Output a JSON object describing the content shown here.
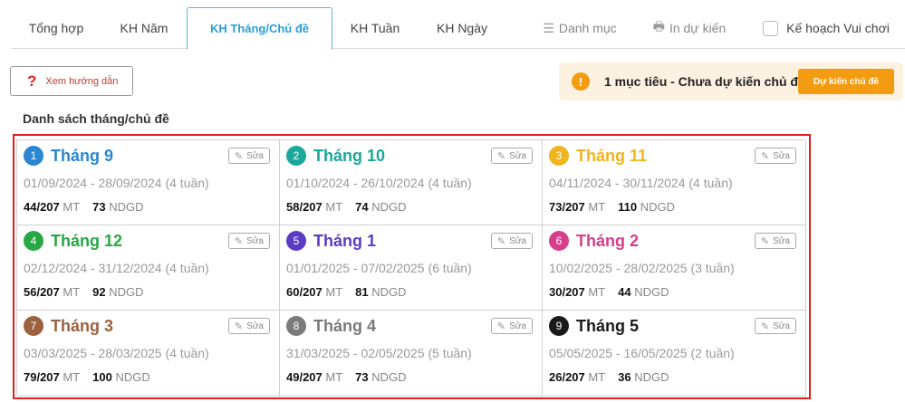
{
  "tabs": [
    {
      "label": "Tổng hợp"
    },
    {
      "label": "KH Năm"
    },
    {
      "label": "KH Tháng/Chủ đề"
    },
    {
      "label": "KH Tuần"
    },
    {
      "label": "KH Ngày"
    },
    {
      "label": "Danh mục",
      "icon": "list-icon"
    },
    {
      "label": "In dự kiến",
      "icon": "print-icon"
    },
    {
      "label": "Kế hoạch Vui chơi"
    }
  ],
  "help_button": {
    "label": "Xem hướng dẫn",
    "icon": "?"
  },
  "alert": {
    "icon": "!",
    "message": "1 mục tiêu - Chưa dự kiến chủ đề",
    "button": "Dự kiến chủ đề",
    "color": "#f39c12"
  },
  "section_title": "Danh sách tháng/chủ đề",
  "edit_label": "Sửa",
  "months": [
    {
      "num": "1",
      "name": "Tháng 9",
      "color": "#2a86d1",
      "dates": "01/09/2024 - 28/09/2024 (4 tuần)",
      "mt": "44/207",
      "mt_label": "MT",
      "ndgd": "73",
      "ndgd_label": "NDGD"
    },
    {
      "num": "2",
      "name": "Tháng 10",
      "color": "#1aa89a",
      "dates": "01/10/2024 - 26/10/2024 (4 tuần)",
      "mt": "58/207",
      "mt_label": "MT",
      "ndgd": "74",
      "ndgd_label": "NDGD"
    },
    {
      "num": "3",
      "name": "Tháng 11",
      "color": "#f0b41c",
      "dates": "04/11/2024 - 30/11/2024 (4 tuần)",
      "mt": "73/207",
      "mt_label": "MT",
      "ndgd": "110",
      "ndgd_label": "NDGD"
    },
    {
      "num": "4",
      "name": "Tháng 12",
      "color": "#27a844",
      "dates": "02/12/2024 - 31/12/2024 (4 tuần)",
      "mt": "56/207",
      "mt_label": "MT",
      "ndgd": "92",
      "ndgd_label": "NDGD"
    },
    {
      "num": "5",
      "name": "Tháng 1",
      "color": "#5b3cc4",
      "dates": "01/01/2025 - 07/02/2025 (6 tuần)",
      "mt": "60/207",
      "mt_label": "MT",
      "ndgd": "81",
      "ndgd_label": "NDGD"
    },
    {
      "num": "6",
      "name": "Tháng 2",
      "color": "#d63e8c",
      "dates": "10/02/2025 - 28/02/2025 (3 tuần)",
      "mt": "30/207",
      "mt_label": "MT",
      "ndgd": "44",
      "ndgd_label": "NDGD"
    },
    {
      "num": "7",
      "name": "Tháng 3",
      "color": "#9c6240",
      "dates": "03/03/2025 - 28/03/2025 (4 tuần)",
      "mt": "79/207",
      "mt_label": "MT",
      "ndgd": "100",
      "ndgd_label": "NDGD"
    },
    {
      "num": "8",
      "name": "Tháng 4",
      "color": "#7a7a7a",
      "dates": "31/03/2025 - 02/05/2025 (5 tuần)",
      "mt": "49/207",
      "mt_label": "MT",
      "ndgd": "73",
      "ndgd_label": "NDGD"
    },
    {
      "num": "9",
      "name": "Tháng 5",
      "color": "#1a1a1a",
      "dates": "05/05/2025 - 16/05/2025 (2 tuần)",
      "mt": "26/207",
      "mt_label": "MT",
      "ndgd": "36",
      "ndgd_label": "NDGD"
    }
  ]
}
